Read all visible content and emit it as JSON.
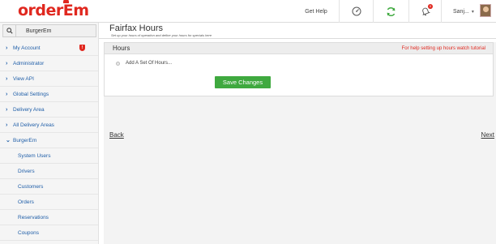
{
  "brand": {
    "logo_text": "orderEm",
    "accent_color": "#e0281f"
  },
  "header": {
    "get_help_label": "Get Help",
    "icons": [
      "gauge-icon",
      "refresh-icon",
      "bell-icon",
      "chevron-down-icon"
    ],
    "user_name": "Sanj...",
    "notification_count": "0"
  },
  "sidebar": {
    "search": {
      "value": "BurgerEm"
    },
    "items": [
      {
        "label": "My Account"
      },
      {
        "label": "Administrator"
      },
      {
        "label": "View API"
      },
      {
        "label": "Global Settings"
      },
      {
        "label": "Delivery Area"
      },
      {
        "label": "All Delivery Areas"
      },
      {
        "label": "BurgerEm"
      }
    ],
    "sub_items": [
      {
        "label": "System Users"
      },
      {
        "label": "Drivers"
      },
      {
        "label": "Customers"
      },
      {
        "label": "Orders"
      },
      {
        "label": "Reservations"
      },
      {
        "label": "Coupons"
      }
    ]
  },
  "main": {
    "title": "Fairfax Hours",
    "subtitle": "Set up your hours of operation and define your hours for specials here",
    "panel": {
      "title": "Hours",
      "help_link": "For help setting up hours watch tutorial",
      "radio_label": "Add A Set Of Hours...",
      "save_label": "Save Changes"
    },
    "back_label": "Back",
    "next_label": "Next"
  },
  "colors": {
    "link_blue": "#1f5ea8",
    "save_green": "#3fa93f",
    "help_red": "#e0281f"
  }
}
